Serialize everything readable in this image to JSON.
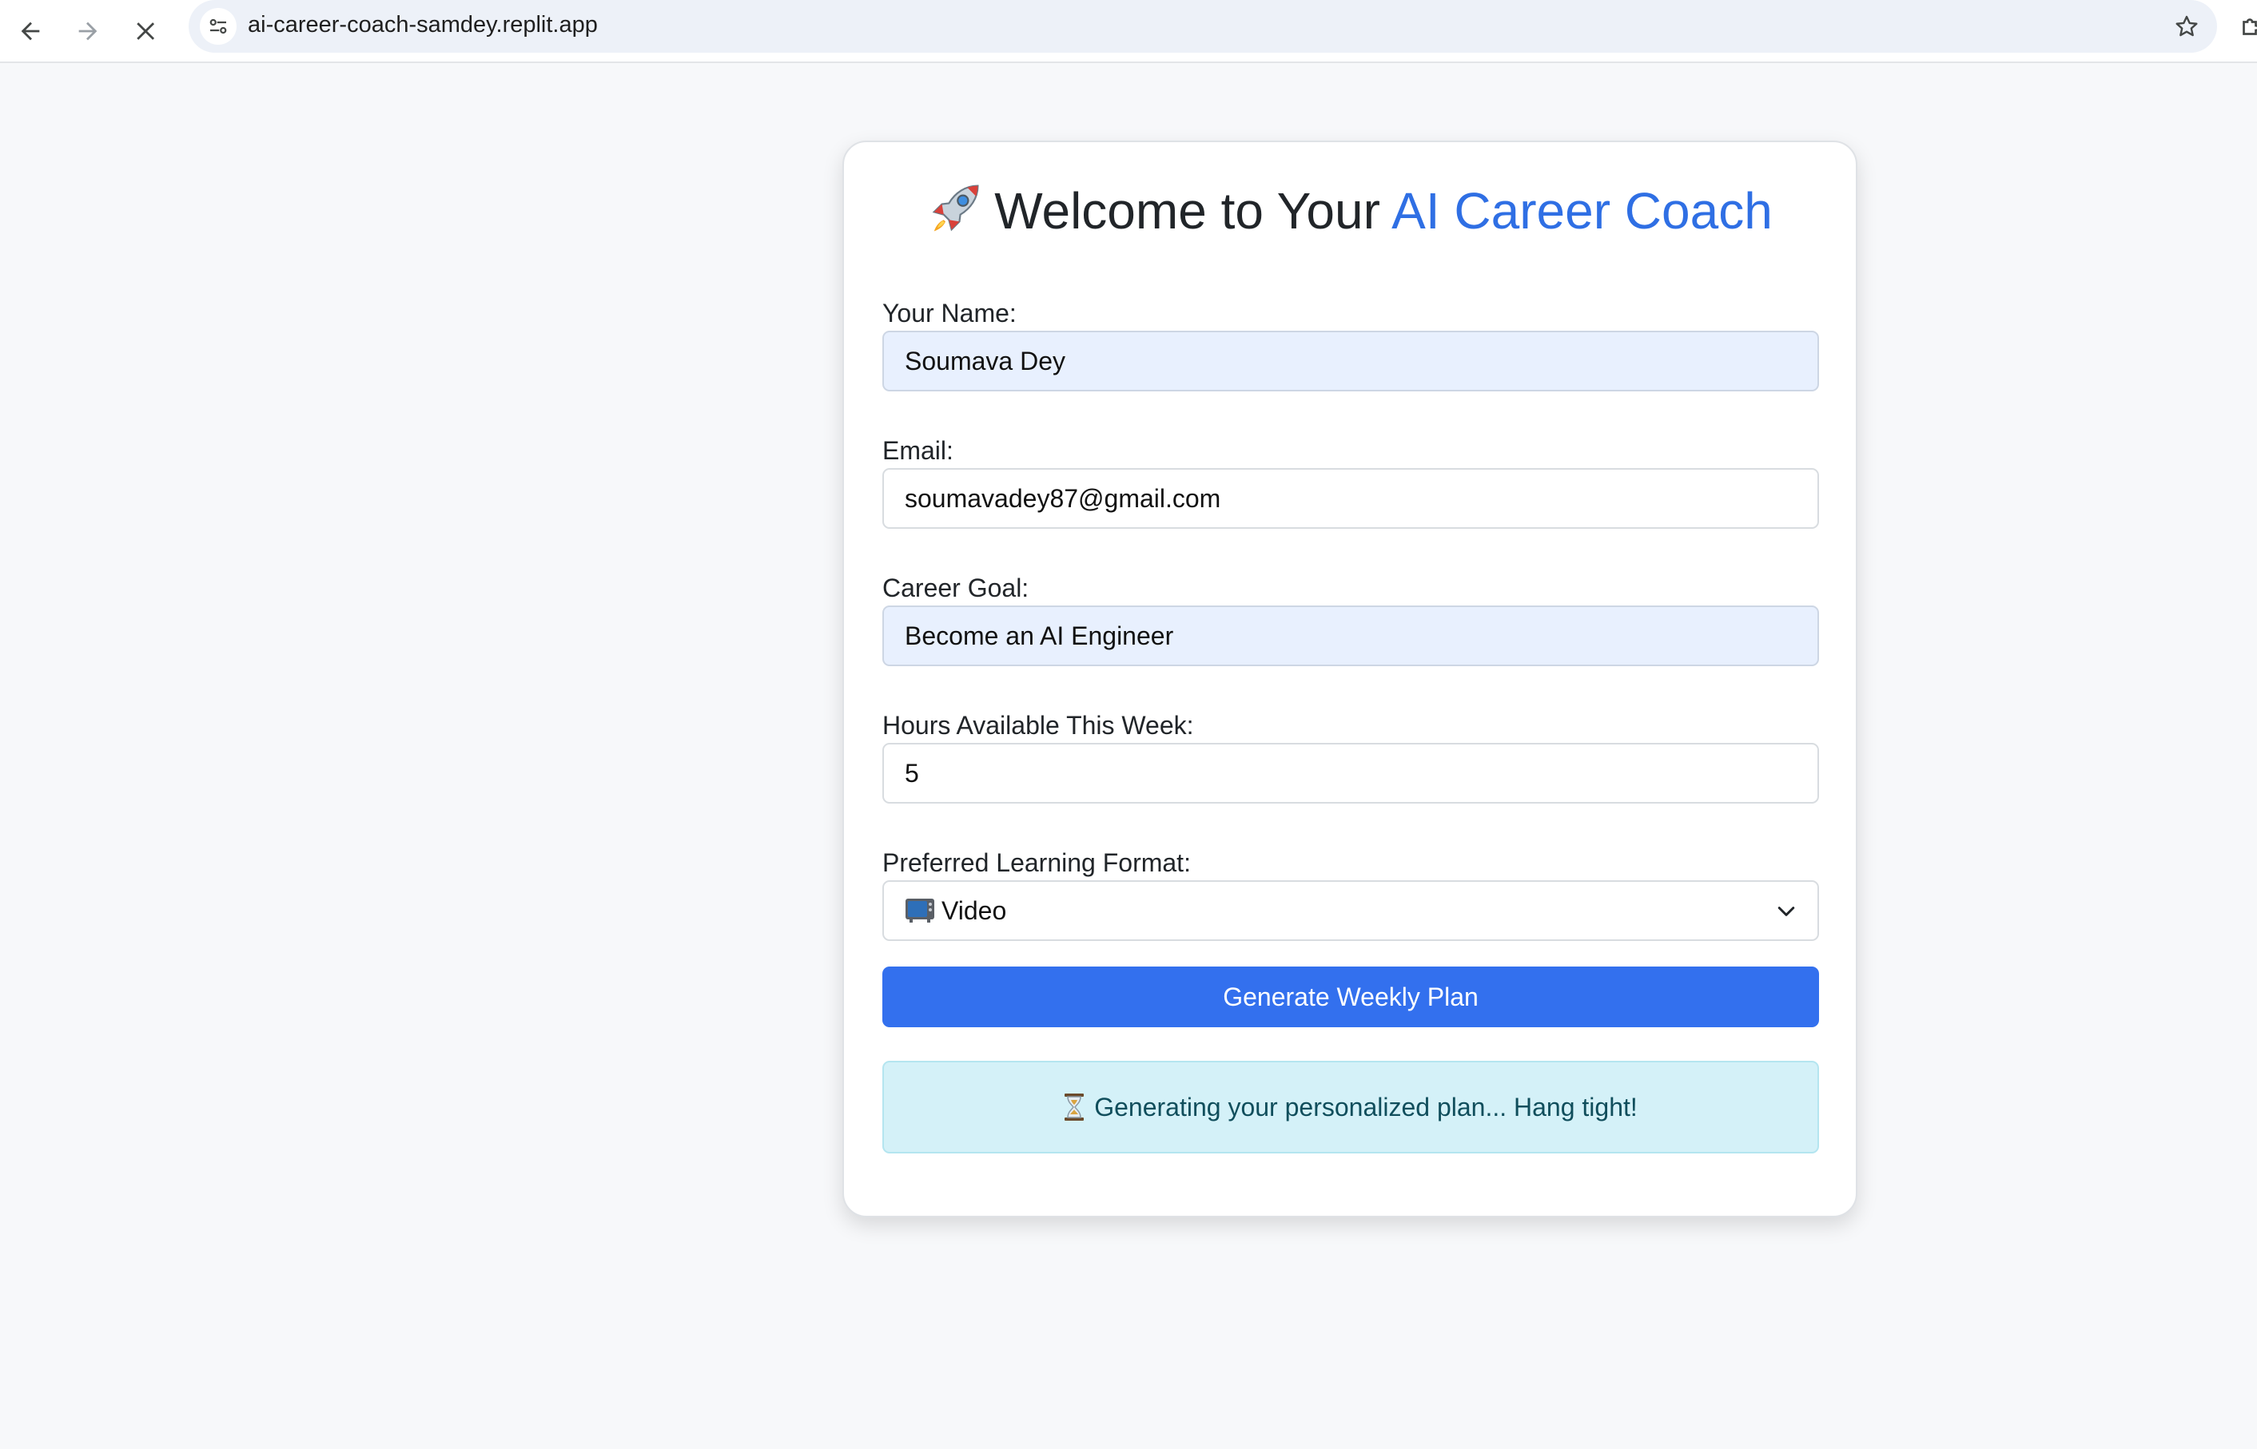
{
  "browser": {
    "url": "ai-career-coach-samdey.replit.app",
    "icons": [
      "back-arrow-icon",
      "forward-arrow-icon",
      "stop-loading-icon",
      "site-info-icon",
      "bookmark-star-icon",
      "extensions-icon"
    ]
  },
  "page": {
    "title_prefix": "Welcome to Your",
    "title_accent": "AI Career Coach",
    "title_icon": "rocket-icon",
    "accent_color": "#2f6fe4",
    "form": {
      "name_label": "Your Name:",
      "name_value": "Soumava Dey",
      "email_label": "Email:",
      "email_value": "soumavadey87@gmail.com",
      "goal_label": "Career Goal:",
      "goal_value": "Become an AI Engineer",
      "hours_label": "Hours Available This Week:",
      "hours_value": "5",
      "format_label": "Preferred Learning Format:",
      "format_value": "Video",
      "format_icon": "tv-icon",
      "submit_label": "Generate Weekly Plan",
      "button_color": "#3370ee"
    },
    "status": {
      "message": "Generating your personalized plan... Hang tight!",
      "icon": "hourglass-icon",
      "background": "#d4f1f8"
    }
  }
}
